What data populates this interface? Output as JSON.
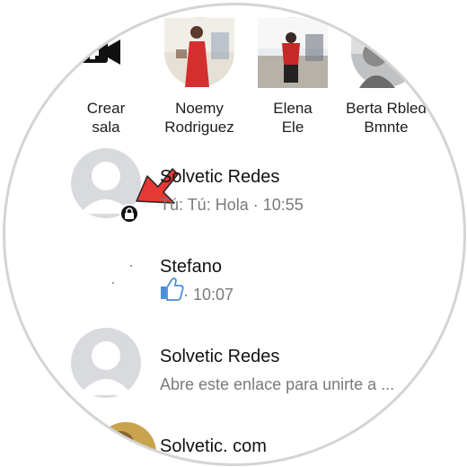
{
  "stories": [
    {
      "label_line1": "Crear",
      "label_line2": "sala",
      "icon": "video-camera-plus-icon"
    },
    {
      "label_line1": "Noemy",
      "label_line2": "Rodriguez",
      "icon": "avatar-photo"
    },
    {
      "label_line1": "Elena",
      "label_line2": "Ele",
      "icon": "avatar-photo"
    },
    {
      "label_line1": "Berta Rbled",
      "label_line2": "Bmnte",
      "icon": "avatar-photo"
    }
  ],
  "chats": [
    {
      "name": "Solvetic Redes",
      "preview": "Tú: Tú: Hola · 10:55",
      "badge": "lock-icon"
    },
    {
      "name": "Stefano",
      "preview_time": "· 10:07",
      "preview_icon": "thumbs-up-icon"
    },
    {
      "name": "Solvetic Redes",
      "preview": "Abre este enlace para unirte a ..."
    },
    {
      "name": "Solvetic. com"
    }
  ],
  "colors": {
    "annotation_arrow": "#e53935",
    "avatar_placeholder": "#d9dade",
    "like_blue": "#4a90d9"
  }
}
